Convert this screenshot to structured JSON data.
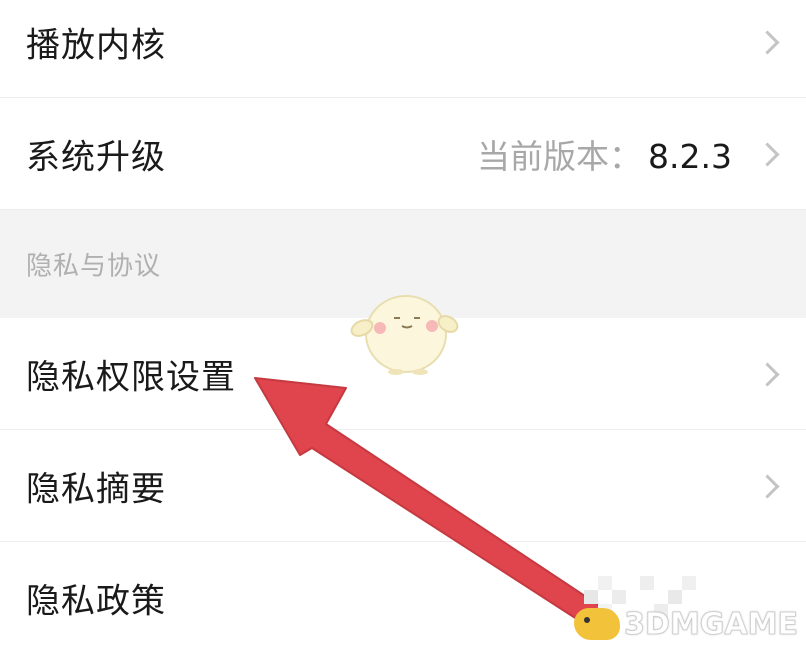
{
  "settings": {
    "rows_top": [
      {
        "label": "播放内核"
      },
      {
        "label": "系统升级",
        "version_label": "当前版本：",
        "version_value": "8.2.3"
      }
    ],
    "section": {
      "title": "隐私与协议"
    },
    "rows_privacy": [
      {
        "label": "隐私权限设置"
      },
      {
        "label": "隐私摘要"
      },
      {
        "label": "隐私政策"
      }
    ]
  },
  "overlay": {
    "arrow_color": "#e0444c",
    "watermark_text": "3DMGAME"
  },
  "icons": {
    "chevron": "chevron-right-icon",
    "annotation_arrow": "annotation-arrow-icon",
    "mascot": "mascot-sticker-icon",
    "watermark_logo": "3dmgame-logo-icon"
  }
}
